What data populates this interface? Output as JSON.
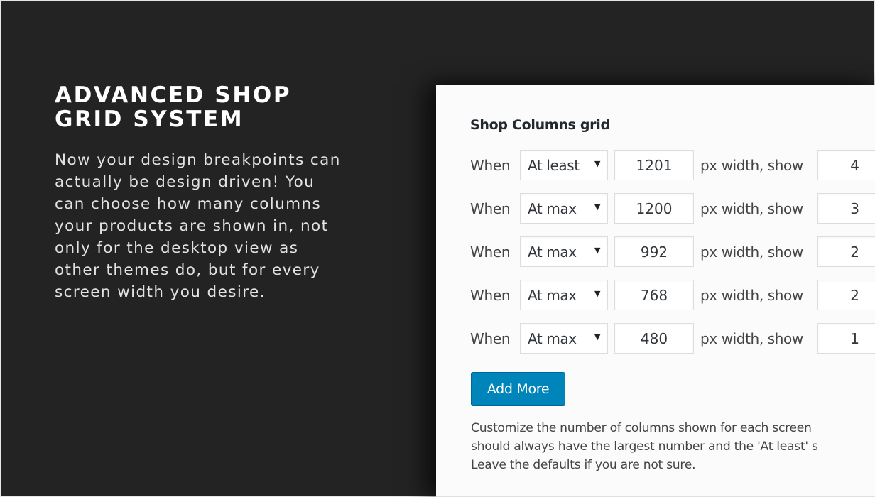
{
  "hero": {
    "title_lines": [
      "ADVANCED SHOP",
      "GRID SYSTEM"
    ],
    "body_lines": [
      "Now your design breakpoints can",
      "actually be design driven! You",
      "can choose how many columns",
      "your products are shown in, not",
      "only for the desktop view as",
      "other themes do, but for every",
      "screen width you desire."
    ]
  },
  "panel": {
    "heading": "Shop Columns grid",
    "rules": [
      {
        "prefix": "When",
        "condition": "At least",
        "width_px": "1201",
        "mid_label": "px width, show",
        "columns": "4"
      },
      {
        "prefix": "When",
        "condition": "At max",
        "width_px": "1200",
        "mid_label": "px width, show",
        "columns": "3"
      },
      {
        "prefix": "When",
        "condition": "At max",
        "width_px": "992",
        "mid_label": "px width, show",
        "columns": "2"
      },
      {
        "prefix": "When",
        "condition": "At max",
        "width_px": "768",
        "mid_label": "px width, show",
        "columns": "2"
      },
      {
        "prefix": "When",
        "condition": "At max",
        "width_px": "480",
        "mid_label": "px width, show",
        "columns": "1"
      }
    ],
    "select_arrow_icon": "▼",
    "add_button_label": "Add More",
    "help_lines": [
      "Customize the number of columns shown for each screen",
      "should always have the largest number and the 'At least' s",
      "Leave the defaults if you are not sure."
    ]
  },
  "colors": {
    "background": "#232323",
    "panel": "#fbfbfb",
    "accent_button": "#0085ba"
  }
}
